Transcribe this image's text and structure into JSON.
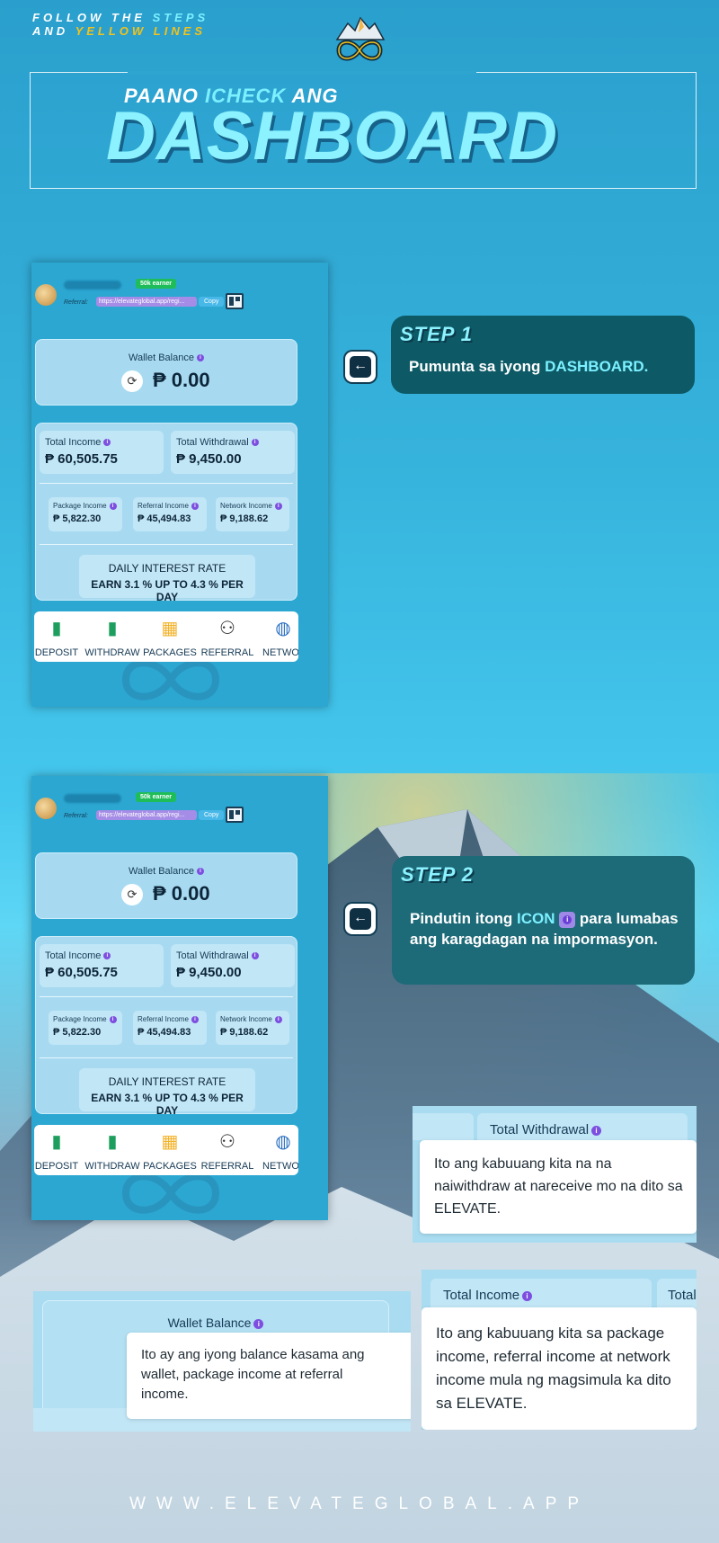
{
  "header": {
    "follow_line1": "FOLLOW THE",
    "follow_steps": "STEPS",
    "follow_line2": "AND",
    "follow_yellow": "YELLOW LINES",
    "title_small_1": "PAANO",
    "title_small_hl": "ICHECK",
    "title_small_2": "ANG",
    "title_big": "DASHBOARD"
  },
  "phone": {
    "earner_badge": "50k earner",
    "referral_label": "Referral:",
    "referral_url": "https://elevateglobal.app/regi...",
    "copy_label": "Copy",
    "wallet_label": "Wallet Balance",
    "wallet_value": "₱ 0.00",
    "total_income_label": "Total Income",
    "total_income_value": "₱ 60,505.75",
    "total_withdrawal_label": "Total Withdrawal",
    "total_withdrawal_value": "₱ 9,450.00",
    "package_income_label": "Package Income",
    "package_income_value": "₱ 5,822.30",
    "referral_income_label": "Referral Income",
    "referral_income_value": "₱ 45,494.83",
    "network_income_label": "Network Income",
    "network_income_value": "₱ 9,188.62",
    "daily_rate_title": "DAILY INTEREST RATE",
    "daily_rate_text": "EARN 3.1 % UP TO 4.3 % PER DAY",
    "nav": [
      "DEPOSIT",
      "WITHDRAW",
      "PACKAGES",
      "REFERRAL",
      "NETWO"
    ]
  },
  "steps": {
    "step1_title": "STEP 1",
    "step1_text_1": "Pumunta sa iyong ",
    "step1_hl": "DASHBOARD.",
    "step2_title": "STEP 2",
    "step2_text_1": "Pindutin itong ",
    "step2_hl": "ICON",
    "step2_text_2": " para lumabas ang karagdagan na impormasyon."
  },
  "tooltips": {
    "withdrawal_header": "Total Withdrawal",
    "withdrawal_text": "Ito ang kabuuang kita na na naiwithdraw at nareceive mo na dito sa ELEVATE.",
    "income_header": "Total Income",
    "income_header_cut": "Total W",
    "income_text": "Ito ang kabuuang kita sa package income, referral income at network income mula ng magsimula ka dito sa ELEVATE.",
    "wallet_header": "Wallet Balance",
    "wallet_text": "Ito ay ang iyong balance kasama ang wallet, package income at referral income."
  },
  "footer": {
    "url": "WWW.ELEVATEGLOBAL.APP"
  },
  "colors": {
    "accent_cyan": "#7cf0ff",
    "accent_yellow": "#f2c21b",
    "step1_bg": "#0d5a66",
    "step2_bg": "#1d6a78",
    "info_purple": "#7d4fe0"
  }
}
